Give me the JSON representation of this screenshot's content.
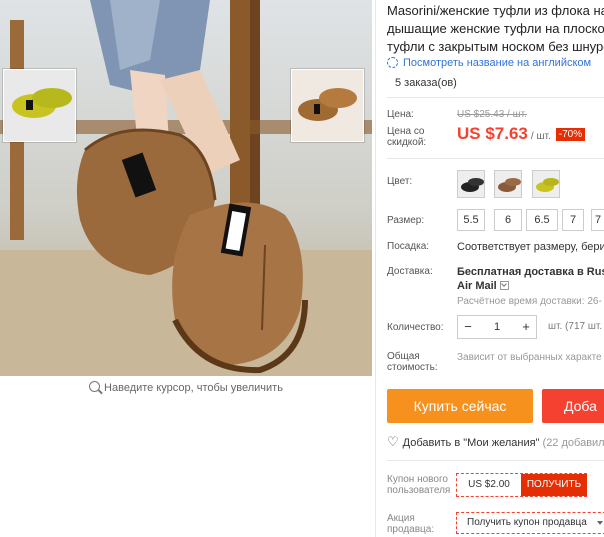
{
  "gallery": {
    "zoom_hint": "Наведите курсор, чтобы увеличить",
    "main_image_alt": "VELO shoe photo"
  },
  "product": {
    "title_lines": [
      "Masorini/женские туфли из флока на",
      "дышащие женские туфли на плоской",
      "туфли с закрытым носком без шнуро"
    ],
    "translate_link": "Посмотреть название на английском",
    "orders": "5 заказа(ов)"
  },
  "price": {
    "old_label": "Цена:",
    "old_value": "US $25.43 / шт.",
    "new_label": "Цена со скидкой:",
    "new_value": "US $7.63",
    "unit": "/ шт.",
    "discount": "-70%"
  },
  "color": {
    "label": "Цвет:"
  },
  "size": {
    "label": "Размер:",
    "options": [
      "5.5",
      "6",
      "6.5",
      "7",
      "7"
    ]
  },
  "fit": {
    "label": "Посадка:",
    "value": "Соответствует размеру, берите"
  },
  "shipping": {
    "label": "Доставка:",
    "line1": "Бесплатная доставка в Russia",
    "line2": "Air Mail",
    "eta": "Расчётное время доставки: 26-"
  },
  "quantity": {
    "label": "Количество:",
    "minus": "−",
    "value": "1",
    "plus": "+",
    "unit": "шт. (717 шт."
  },
  "total": {
    "label": "Общая стоимость:",
    "value": "Зависит от выбранных характе"
  },
  "actions": {
    "buy_now": "Купить сейчас",
    "add_to_cart": "Доба",
    "wishlist_prefix": "Добавить в \"Мои желания\"",
    "wishlist_count": "(22 добавили)"
  },
  "coupons": {
    "new_user_label": "Купон нового пользователя",
    "new_user_amount": "US $2.00",
    "get": "ПОЛУЧИТЬ",
    "seller_label": "Акция продавца:",
    "seller_button": "Получить купон продавца"
  },
  "colors": {
    "price_red": "#f5412f",
    "buy_orange": "#f6911e",
    "link_blue": "#2f73d8"
  }
}
